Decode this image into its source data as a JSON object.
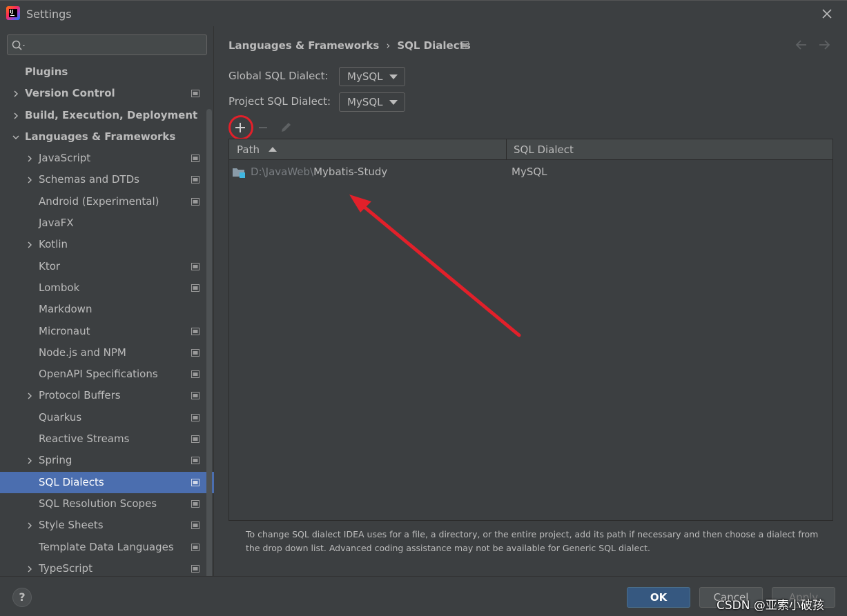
{
  "window": {
    "title": "Settings"
  },
  "sidebar": {
    "search_value": "",
    "items": [
      {
        "label": "Plugins",
        "indent": 0,
        "bold": true,
        "chevron": "none",
        "project": false,
        "selected": false
      },
      {
        "label": "Version Control",
        "indent": 0,
        "bold": true,
        "chevron": "right",
        "project": true,
        "selected": false
      },
      {
        "label": "Build, Execution, Deployment",
        "indent": 0,
        "bold": true,
        "chevron": "right",
        "project": false,
        "selected": false
      },
      {
        "label": "Languages & Frameworks",
        "indent": 0,
        "bold": true,
        "chevron": "down",
        "project": false,
        "selected": false
      },
      {
        "label": "JavaScript",
        "indent": 1,
        "bold": false,
        "chevron": "right",
        "project": true,
        "selected": false
      },
      {
        "label": "Schemas and DTDs",
        "indent": 1,
        "bold": false,
        "chevron": "right",
        "project": true,
        "selected": false
      },
      {
        "label": "Android (Experimental)",
        "indent": 1,
        "bold": false,
        "chevron": "none",
        "project": true,
        "selected": false
      },
      {
        "label": "JavaFX",
        "indent": 1,
        "bold": false,
        "chevron": "none",
        "project": false,
        "selected": false
      },
      {
        "label": "Kotlin",
        "indent": 1,
        "bold": false,
        "chevron": "right",
        "project": false,
        "selected": false
      },
      {
        "label": "Ktor",
        "indent": 1,
        "bold": false,
        "chevron": "none",
        "project": true,
        "selected": false
      },
      {
        "label": "Lombok",
        "indent": 1,
        "bold": false,
        "chevron": "none",
        "project": true,
        "selected": false
      },
      {
        "label": "Markdown",
        "indent": 1,
        "bold": false,
        "chevron": "none",
        "project": false,
        "selected": false
      },
      {
        "label": "Micronaut",
        "indent": 1,
        "bold": false,
        "chevron": "none",
        "project": true,
        "selected": false
      },
      {
        "label": "Node.js and NPM",
        "indent": 1,
        "bold": false,
        "chevron": "none",
        "project": true,
        "selected": false
      },
      {
        "label": "OpenAPI Specifications",
        "indent": 1,
        "bold": false,
        "chevron": "none",
        "project": true,
        "selected": false
      },
      {
        "label": "Protocol Buffers",
        "indent": 1,
        "bold": false,
        "chevron": "right",
        "project": true,
        "selected": false
      },
      {
        "label": "Quarkus",
        "indent": 1,
        "bold": false,
        "chevron": "none",
        "project": true,
        "selected": false
      },
      {
        "label": "Reactive Streams",
        "indent": 1,
        "bold": false,
        "chevron": "none",
        "project": true,
        "selected": false
      },
      {
        "label": "Spring",
        "indent": 1,
        "bold": false,
        "chevron": "right",
        "project": true,
        "selected": false
      },
      {
        "label": "SQL Dialects",
        "indent": 1,
        "bold": false,
        "chevron": "none",
        "project": true,
        "selected": true
      },
      {
        "label": "SQL Resolution Scopes",
        "indent": 1,
        "bold": false,
        "chevron": "none",
        "project": true,
        "selected": false
      },
      {
        "label": "Style Sheets",
        "indent": 1,
        "bold": false,
        "chevron": "right",
        "project": true,
        "selected": false
      },
      {
        "label": "Template Data Languages",
        "indent": 1,
        "bold": false,
        "chevron": "none",
        "project": true,
        "selected": false
      },
      {
        "label": "TypeScript",
        "indent": 1,
        "bold": false,
        "chevron": "right",
        "project": true,
        "selected": false
      }
    ]
  },
  "breadcrumb": {
    "parent": "Languages & Frameworks",
    "separator": "›",
    "current": "SQL Dialects"
  },
  "global_dialect": {
    "label": "Global SQL Dialect:",
    "value": "MySQL"
  },
  "project_dialect": {
    "label": "Project SQL Dialect:",
    "value": "MySQL"
  },
  "table": {
    "columns": {
      "path": "Path",
      "dialect": "SQL Dialect"
    },
    "rows": [
      {
        "path_prefix": "D:\\JavaWeb\\",
        "path_name": "Mybatis-Study",
        "dialect": "MySQL"
      }
    ]
  },
  "hint": "To change SQL dialect IDEA uses for a file, a directory, or the entire project, add its path if necessary and then choose a dialect from the drop down list. Advanced coding assistance may not be available for Generic SQL dialect.",
  "buttons": {
    "help": "?",
    "ok": "OK",
    "cancel": "Cancel",
    "apply": "Apply"
  },
  "watermark": "CSDN @亚索小破孩",
  "colors": {
    "selection": "#4b6eaf",
    "annotation": "#e2202a",
    "ok_button": "#365880"
  }
}
